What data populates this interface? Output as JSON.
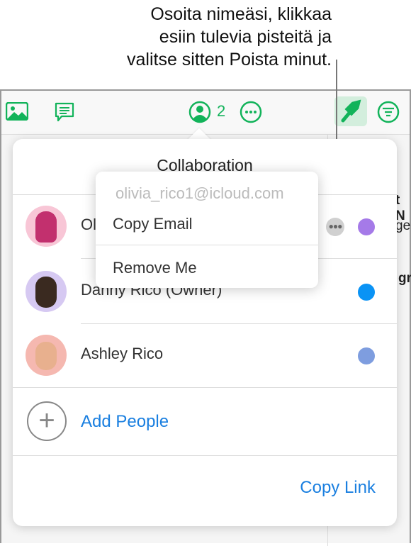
{
  "callout": {
    "lines": [
      "Osoita nimeäsi, klikkaa",
      "esiin tulevia pisteitä ja",
      "valitse sitten Poista minut."
    ]
  },
  "toolbar": {
    "collab_count": "2"
  },
  "background": {
    "frag1": "t N",
    "frag2": "ge",
    "frag3": "gr"
  },
  "popover": {
    "title": "Collaboration",
    "people": [
      {
        "name": "Olivia Rico",
        "color": "#a57ae8"
      },
      {
        "name": "Danny Rico (Owner)",
        "color": "#0a93f5"
      },
      {
        "name": "Ashley Rico",
        "color": "#7e9ddf"
      }
    ],
    "add_people": "Add People",
    "copy_link": "Copy Link"
  },
  "menu": {
    "email": "olivia_rico1@icloud.com",
    "copy_email": "Copy Email",
    "remove_me": "Remove Me"
  },
  "colors": {
    "accent": "#12b35a",
    "link": "#1a7fe0"
  }
}
